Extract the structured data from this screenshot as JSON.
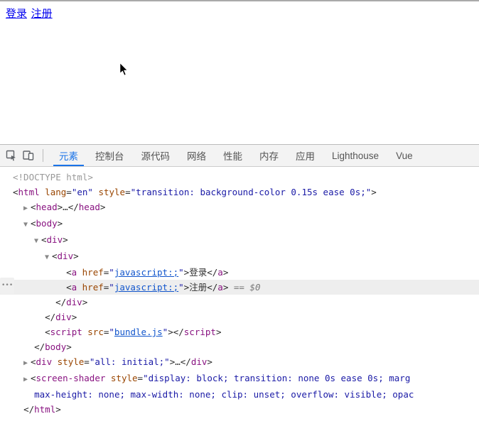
{
  "page": {
    "login_link": "登录",
    "register_link": "注册"
  },
  "devtools": {
    "tabs": {
      "elements": "元素",
      "console": "控制台",
      "sources": "源代码",
      "network": "网络",
      "performance": "性能",
      "memory": "内存",
      "application": "应用",
      "lighthouse": "Lighthouse",
      "vue": "Vue"
    },
    "dom": {
      "doctype": "<!DOCTYPE html>",
      "html_open": "<html lang=\"en\" style=\"transition: background-color 0.15s ease 0s;\">",
      "head": "<head>…</head>",
      "body_open": "<body>",
      "div1_open": "<div>",
      "div2_open": "<div>",
      "a_login_href": "javascript:;",
      "a_login_text": "登录",
      "a_register_href": "javascript:;",
      "a_register_text": "注册",
      "selected_suffix": " == $0",
      "div2_close": "</div>",
      "div1_close": "</div>",
      "script_src": "bundle.js",
      "body_close": "</body>",
      "extra_div": "<div style=\"all: initial;\">…</div>",
      "screen_shader_1": "<screen-shader style=\"display: block; transition: none 0s ease 0s; marg",
      "screen_shader_2": "max-height: none; max-width: none; clip: unset; overflow: visible; opac",
      "html_close": "</html>"
    }
  }
}
